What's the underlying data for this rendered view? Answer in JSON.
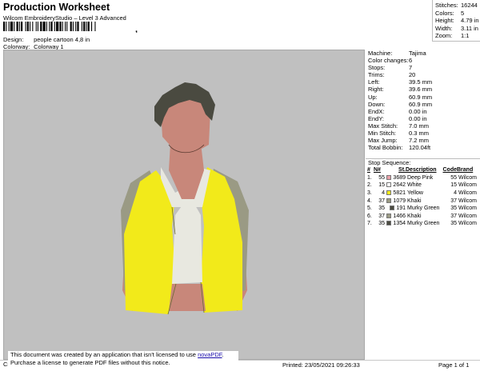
{
  "header": {
    "title": "Production Worksheet",
    "subtitle": "Wilcom EmbroideryStudio – Level 3 Advanced",
    "barcode_tail": ",",
    "design_label": "Design:",
    "design_value": "people cartoon 4,8 in",
    "colorway_label": "Colorway:",
    "colorway_value": "Colorway 1"
  },
  "summary": [
    {
      "label": "Stitches:",
      "value": "16244"
    },
    {
      "label": "Colors:",
      "value": "5"
    },
    {
      "label": "Height:",
      "value": "4.79 in"
    },
    {
      "label": "Width:",
      "value": "3.11 in"
    },
    {
      "label": "Zoom:",
      "value": "1:1"
    }
  ],
  "stats": [
    {
      "label": "Machine:",
      "value": "Tajima"
    },
    {
      "label": "Color changes:",
      "value": "6"
    },
    {
      "label": "Stops:",
      "value": "7"
    },
    {
      "label": "Trims:",
      "value": "20"
    },
    {
      "label": "Left:",
      "value": "39.5 mm"
    },
    {
      "label": "Right:",
      "value": "39.6 mm"
    },
    {
      "label": "Up:",
      "value": "60.9 mm"
    },
    {
      "label": "Down:",
      "value": "60.9 mm"
    },
    {
      "label": "EndX:",
      "value": "0.00 in"
    },
    {
      "label": "EndY:",
      "value": "0.00 in"
    },
    {
      "label": "Max Stitch:",
      "value": "7.0 mm"
    },
    {
      "label": "Min Stitch:",
      "value": "0.3 mm"
    },
    {
      "label": "Max Jump:",
      "value": "7.2 mm"
    },
    {
      "label": "Total Bobbin:",
      "value": "120.04ft"
    }
  ],
  "stop_sequence": {
    "title": "Stop Sequence:",
    "headers": [
      "#",
      "N#",
      "St.",
      "Description",
      "Code",
      "Brand"
    ],
    "rows": [
      {
        "n": "1.",
        "needle": "55",
        "color": "#e8a0a8",
        "st": "3689",
        "desc": "Deep Pink",
        "code": "55",
        "brand": "Wilcom"
      },
      {
        "n": "2.",
        "needle": "15",
        "color": "#ffffff",
        "st": "2642",
        "desc": "White",
        "code": "15",
        "brand": "Wilcom"
      },
      {
        "n": "3.",
        "needle": "4",
        "color": "#f2ea1a",
        "st": "5821",
        "desc": "Yellow",
        "code": "4",
        "brand": "Wilcom"
      },
      {
        "n": "4.",
        "needle": "37",
        "color": "#9a9a84",
        "st": "1079",
        "desc": "Khaki",
        "code": "37",
        "brand": "Wilcom"
      },
      {
        "n": "5.",
        "needle": "35",
        "color": "#4a4a40",
        "st": "191",
        "desc": "Murky Green",
        "code": "35",
        "brand": "Wilcom"
      },
      {
        "n": "6.",
        "needle": "37",
        "color": "#9a9a84",
        "st": "1466",
        "desc": "Khaki",
        "code": "37",
        "brand": "Wilcom"
      },
      {
        "n": "7.",
        "needle": "35",
        "color": "#4a4a40",
        "st": "1354",
        "desc": "Murky Green",
        "code": "35",
        "brand": "Wilcom"
      }
    ]
  },
  "footer": {
    "notice_line1": "This document was created by an application that isn't licensed to use ",
    "notice_link": "novaPDF",
    "notice_line1_end": ".",
    "notice_line2": "Purchase a license to generate PDF files without this notice.",
    "cr": "Cr",
    "printed": "Printed: 23/05/2021 09:26:33",
    "page": "Page 1 of 1"
  },
  "colors": {
    "canvas_bg": "#c0c0c0",
    "skin": "#c8877a",
    "hair": "#4a4a40",
    "shirt": "#f2ea1a",
    "vest": "#9a9a84",
    "tank": "#e8e8e0"
  }
}
